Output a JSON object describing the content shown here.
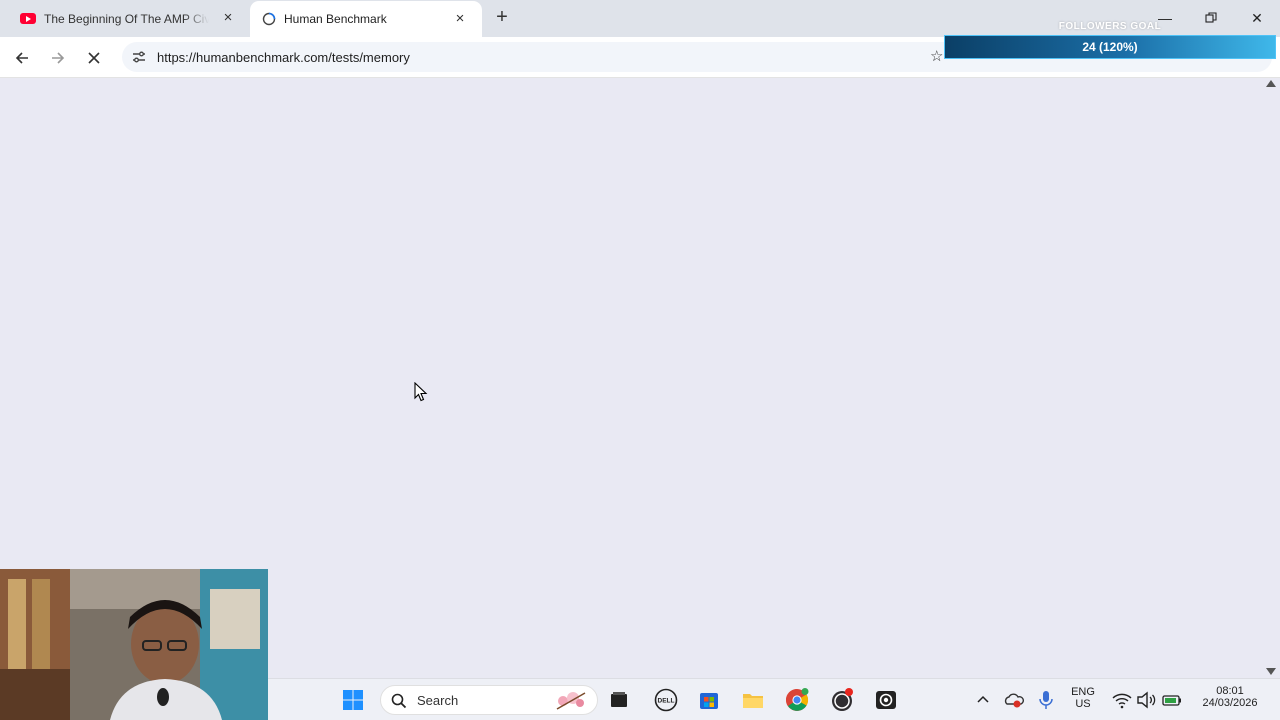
{
  "tabs": [
    {
      "title": "The Beginning Of The AMP Civi",
      "icon": "youtube-icon"
    },
    {
      "title": "Human Benchmark",
      "icon": "globe-icon"
    }
  ],
  "address_bar": {
    "url": "https://humanbenchmark.com/tests/memory"
  },
  "overlay": {
    "title": "FOLLOWERS GOAL",
    "value": "24 (120%)",
    "progress": 1.0
  },
  "taskbar": {
    "search_placeholder": "Search",
    "language": "ENG",
    "region": "US",
    "time": "08:01",
    "date": "24/03/2026"
  },
  "colors": {
    "tab_strip": "#dfe3ea",
    "page_bg": "#e9e9f3",
    "goal_bar": "#1b6fa8",
    "youtube_red": "#ff0033"
  }
}
